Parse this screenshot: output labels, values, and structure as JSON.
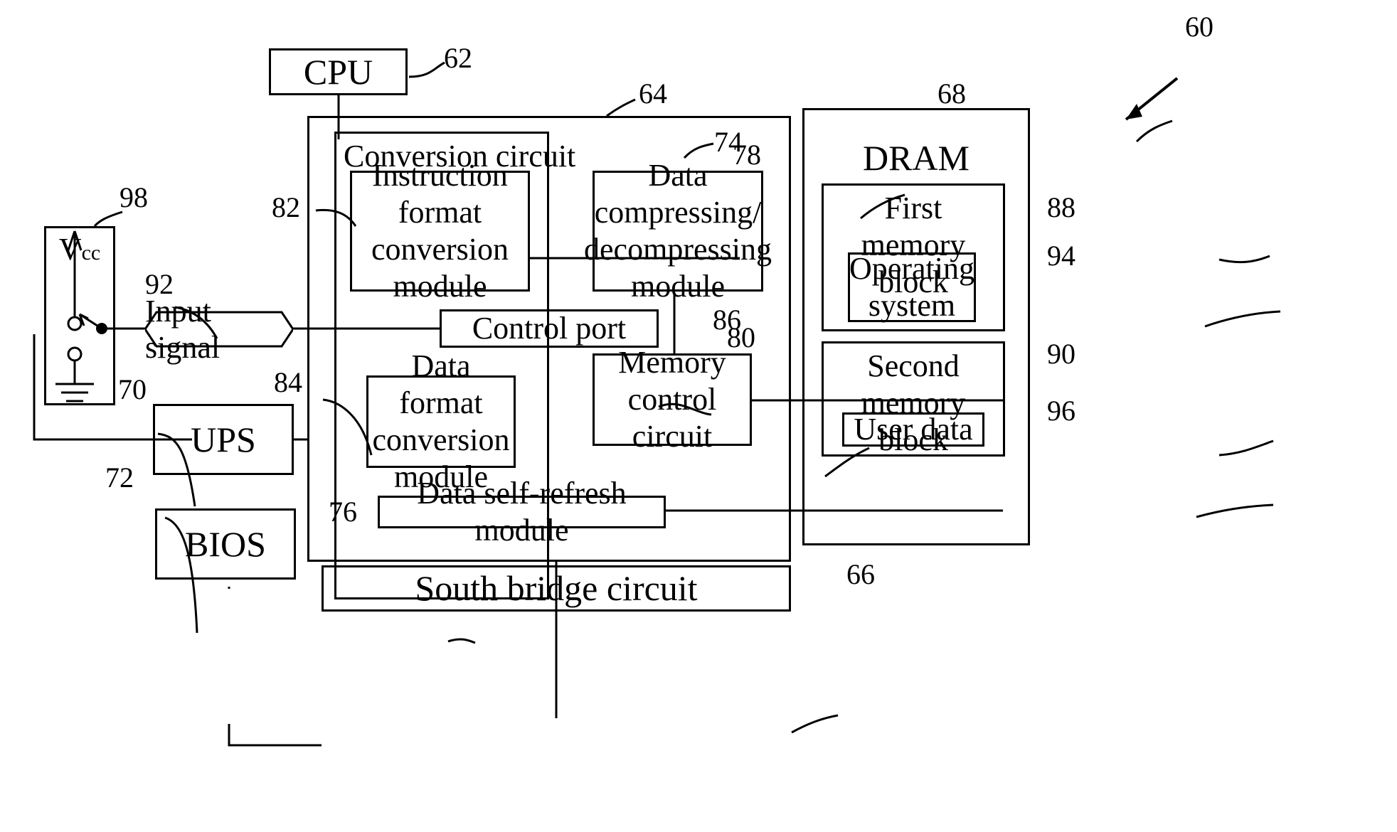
{
  "figure": {
    "type": "patent-block-diagram",
    "overall_ref": "60"
  },
  "blocks": {
    "cpu": {
      "label": "CPU",
      "ref": "62"
    },
    "north_bridge": {
      "label": "",
      "ref": "64"
    },
    "conversion": {
      "label": "Conversion circuit",
      "ref": "74"
    },
    "instruction": {
      "label": "Instruction format conversion module",
      "ref": "82",
      "lines": [
        "Instruction",
        "format",
        "conversion",
        "module"
      ]
    },
    "control_port": {
      "label": "Control port",
      "ref": "86"
    },
    "data_format": {
      "label": "Data format conversion module",
      "ref": "84",
      "lines": [
        "Data format",
        "conversion",
        "module"
      ]
    },
    "data_compress": {
      "label": "Data compressing/decompressing module",
      "ref": "78",
      "lines": [
        "Data",
        "compressing/",
        "decompressing",
        "module"
      ]
    },
    "mem_control": {
      "label": "Memory control circuit",
      "ref": "80",
      "lines": [
        "Memory",
        "control",
        "circuit"
      ]
    },
    "self_refresh": {
      "label": "Data self-refresh module",
      "ref": "76"
    },
    "south_bridge": {
      "label": "South bridge circuit",
      "ref": "66"
    },
    "dram": {
      "label": "DRAM",
      "ref": "68"
    },
    "first_block": {
      "label": "First memory block",
      "ref": "88",
      "lines": [
        "First",
        "memory block"
      ]
    },
    "operating_sys": {
      "label": "Operating system",
      "ref": "94",
      "lines": [
        "Operating",
        "system"
      ]
    },
    "second_block": {
      "label": "Second memory block",
      "ref": "90",
      "lines": [
        "Second",
        "memory block"
      ]
    },
    "user_data": {
      "label": "User data",
      "ref": "96"
    },
    "ups": {
      "label": "UPS",
      "ref": "70"
    },
    "bios": {
      "label": "BIOS",
      "ref": "72"
    },
    "power_source": {
      "label": "Vcc",
      "ref": "98",
      "label_main": "V",
      "label_sub": "cc"
    },
    "input_signal": {
      "label": "Input signal",
      "ref": "92"
    }
  },
  "reference_numerals": [
    "60",
    "62",
    "64",
    "66",
    "68",
    "70",
    "72",
    "74",
    "76",
    "78",
    "80",
    "82",
    "84",
    "86",
    "88",
    "90",
    "92",
    "94",
    "96",
    "98"
  ],
  "colors": {
    "ink": "#000000",
    "paper": "#ffffff"
  }
}
